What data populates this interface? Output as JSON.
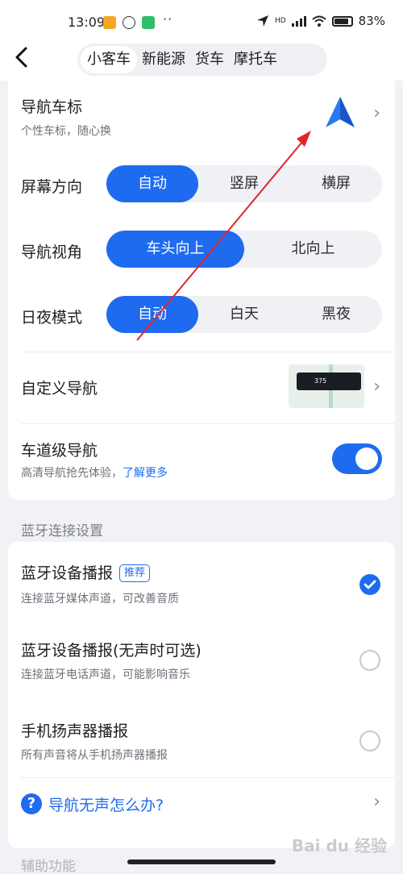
{
  "status_bar": {
    "time": "13:09",
    "dots": "··",
    "network": "HD",
    "battery": "83%"
  },
  "header": {
    "back_glyph": "‹",
    "tabs": [
      "小客车",
      "新能源",
      "货车",
      "摩托车"
    ],
    "active_tab": 0
  },
  "nav_marker": {
    "title": "导航车标",
    "subtitle": "个性车标，随心换"
  },
  "screen_orientation": {
    "label": "屏幕方向",
    "options": [
      "自动",
      "竖屏",
      "横屏"
    ],
    "selected": "自动"
  },
  "nav_view": {
    "label": "导航视角",
    "options": [
      "车头向上",
      "北向上"
    ],
    "selected": "车头向上"
  },
  "day_night": {
    "label": "日夜模式",
    "options": [
      "自动",
      "白天",
      "黑夜"
    ],
    "selected": "自动"
  },
  "custom_nav": {
    "label": "自定义导航",
    "preview_text": "375"
  },
  "lane_nav": {
    "title": "车道级导航",
    "subtitle": "高清导航抢先体验，",
    "link": "了解更多",
    "enabled": true
  },
  "bluetooth": {
    "section_label": "蓝牙连接设置",
    "items": [
      {
        "title": "蓝牙设备播报",
        "badge": "推荐",
        "subtitle": "连接蓝牙媒体声道，可改善音质",
        "checked": true
      },
      {
        "title": "蓝牙设备播报(无声时可选)",
        "subtitle": "连接蓝牙电话声道，可能影响音乐",
        "checked": false
      },
      {
        "title": "手机扬声器播报",
        "subtitle": "所有声音将从手机扬声器播报",
        "checked": false
      }
    ],
    "help": "导航无声怎么办?"
  },
  "peek_text": "辅助功能",
  "watermark": "Bai du 经验",
  "colors": {
    "accent": "#1f6bf0",
    "annotation": "#e0242c"
  }
}
